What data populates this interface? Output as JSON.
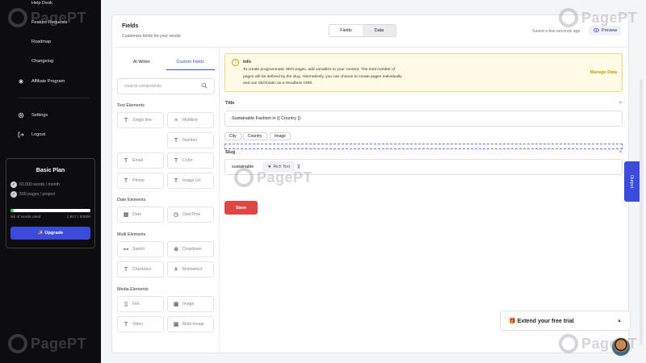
{
  "brand": {
    "watermark": "PagePT"
  },
  "sidebar": {
    "items": [
      {
        "label": "Help Desk",
        "icon": "help-icon"
      },
      {
        "label": "Feature Requests",
        "icon": "lightbulb-icon"
      },
      {
        "label": "Roadmap",
        "icon": "map-icon"
      },
      {
        "label": "Changelog",
        "icon": "list-icon"
      },
      {
        "label": "Affiliate Program",
        "icon": "affiliate-icon"
      },
      {
        "label": "Settings",
        "icon": "gear-icon"
      },
      {
        "label": "Logout",
        "icon": "logout-icon"
      }
    ],
    "plan": {
      "title": "Basic Plan",
      "features": [
        "50,000 words / month",
        "500 pages / project"
      ],
      "usage_label": "Nb of words used",
      "usage_value": "1,917 / 50000",
      "usage_fraction": 0.038,
      "upgrade_label": "✨ Upgrade"
    }
  },
  "header": {
    "title": "Fields",
    "subtitle": "Customize fields for your needs",
    "toggle": [
      "Fields",
      "Data"
    ],
    "saved": "Saved a few seconds ago",
    "preview": "Preview"
  },
  "left": {
    "tabs": [
      "AI Writer",
      "Custom Fields"
    ],
    "search_placeholder": "Search components",
    "sections": {
      "text": "Text Elements",
      "date": "Date Elements",
      "multi": "Multi Elements",
      "media": "Media Elements"
    },
    "components": {
      "single_line": "Single line",
      "multiline": "Multiline",
      "number": "Number",
      "email": "Email",
      "color": "Color",
      "phone": "Phone",
      "image_url": "Image Url",
      "date": "Date",
      "datetime": "DateTime",
      "switch": "Switch",
      "dropdown": "Dropdown",
      "checkbox": "Checkbox",
      "multiselect": "Multiselect",
      "file": "File",
      "image": "Image",
      "video": "Video",
      "multi_image": "Multi Image"
    }
  },
  "right": {
    "info": {
      "title": "Info",
      "body": "To create programmatic SEO pages, add variables to your content. The total number of pages will be defined by the slug. Alternatively, you can choose to create pages individually and use SEOmatic as a Headless CMS.",
      "manage": "Manage Data"
    },
    "title_label": "Title",
    "title_value": "Sustainable Fashion in {{ Country }}",
    "chips": [
      "City",
      "Country",
      "Image"
    ],
    "slug_label": "Slug",
    "slug_value": "sustainable",
    "slug_tail": ")}",
    "rich_text": "Rich Text",
    "save": "Save"
  },
  "output_tab": "Output",
  "trial": "🎁 Extend your free trial"
}
